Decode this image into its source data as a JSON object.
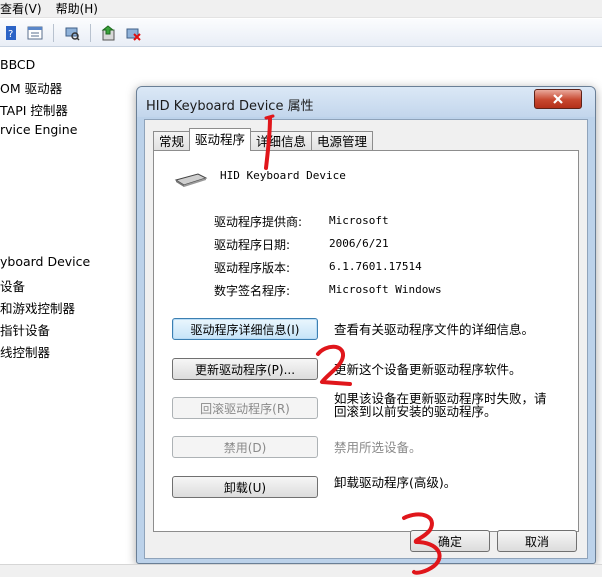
{
  "menubar": [
    "查看(V)",
    "帮助(H)"
  ],
  "tree": [
    "BBCD",
    "OM 驱动器",
    "TAPI 控制器",
    "rvice Engine",
    "yboard Device",
    "设备",
    "和游戏控制器",
    "指针设备",
    "线控制器"
  ],
  "dialog": {
    "title": "HID Keyboard Device 属性",
    "tabs": [
      "常规",
      "驱动程序",
      "详细信息",
      "电源管理"
    ],
    "device_name": "HID Keyboard Device",
    "props": [
      {
        "label": "驱动程序提供商:",
        "value": "Microsoft"
      },
      {
        "label": "驱动程序日期:",
        "value": "2006/6/21"
      },
      {
        "label": "驱动程序版本:",
        "value": "6.1.7601.17514"
      },
      {
        "label": "数字签名程序:",
        "value": "Microsoft Windows"
      }
    ],
    "actions": [
      {
        "label": "驱动程序详细信息(I)",
        "desc": "查看有关驱动程序文件的详细信息。",
        "enabled": true
      },
      {
        "label": "更新驱动程序(P)...",
        "desc": "更新这个设备更新驱动程序软件。",
        "enabled": true
      },
      {
        "label": "回滚驱动程序(R)",
        "desc": "如果该设备在更新驱动程序时失败，请\n回滚到以前安装的驱动程序。",
        "enabled": false
      },
      {
        "label": "禁用(D)",
        "desc": "禁用所选设备。",
        "enabled": false
      },
      {
        "label": "卸载(U)",
        "desc": "卸载驱动程序(高级)。",
        "enabled": true
      }
    ],
    "ok_label": "确定",
    "cancel_label": "取消"
  },
  "annotations": [
    "1",
    "2",
    "3"
  ],
  "colors": {
    "annotation": "#e0161b",
    "close_button": "#c7472f",
    "dialog_frame": "#bcd2ea"
  }
}
